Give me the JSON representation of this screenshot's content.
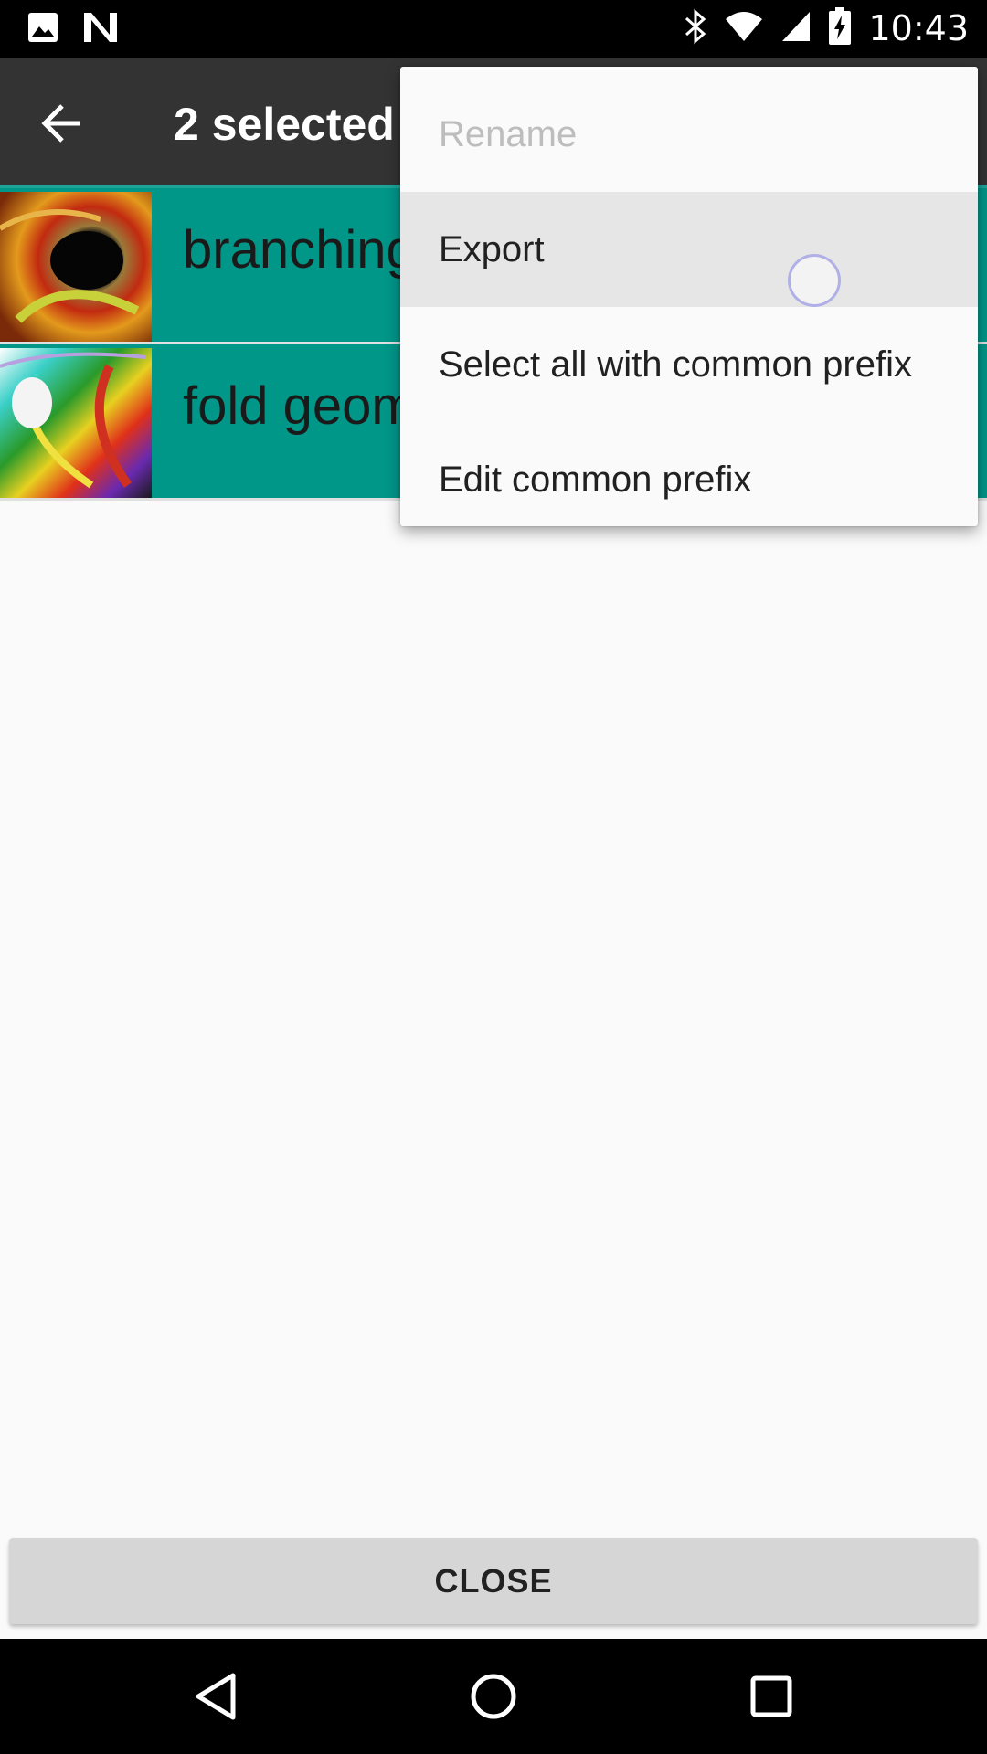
{
  "status_bar": {
    "time": "10:43",
    "left_icons": [
      "image-icon",
      "n-notification-icon"
    ],
    "right_icons": [
      "bluetooth-icon",
      "wifi-icon",
      "signal-icon",
      "battery-charging-icon"
    ]
  },
  "toolbar": {
    "back_icon": "arrow-back-icon",
    "title": "2 selected",
    "accent_color": "#1ea497"
  },
  "list": {
    "background_color": "#009688",
    "items": [
      {
        "label": "branching",
        "thumbnail": "fractal-thumbnail-1"
      },
      {
        "label": "fold geom",
        "thumbnail": "fractal-thumbnail-2"
      }
    ]
  },
  "menu": {
    "items": [
      {
        "label": "Rename",
        "enabled": false
      },
      {
        "label": "Export",
        "enabled": true
      },
      {
        "label": "Select all with common prefix",
        "enabled": true
      },
      {
        "label": "Edit common prefix",
        "enabled": true
      }
    ]
  },
  "close_button": {
    "label": "CLOSE"
  },
  "nav_bar": {
    "icons": [
      "back-triangle-icon",
      "home-circle-icon",
      "recents-square-icon"
    ]
  }
}
